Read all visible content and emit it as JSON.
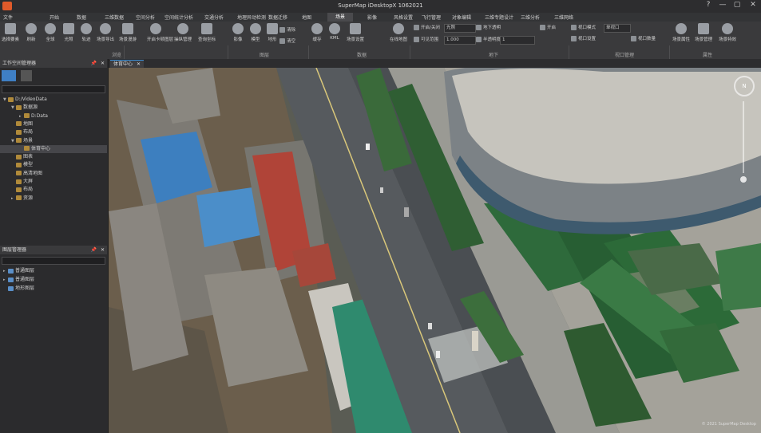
{
  "window": {
    "title": "SuperMap iDesktopX 1062021",
    "minimize": "—",
    "maximize": "▢",
    "close": "✕",
    "help": "?"
  },
  "menu": [
    "文件",
    "开始",
    "数据",
    "三维数据",
    "空间分析",
    "空间统计分析",
    "交通分析",
    "地理异动检测",
    "数据迁移",
    "地图",
    "场景",
    "影像",
    "风格设置",
    "飞行管理",
    "对象编辑",
    "三维专题设计",
    "三维分析",
    "三维网络"
  ],
  "menu_active": "场景",
  "ribbon": {
    "buttons": [
      {
        "label": "选择要素",
        "icon": "select-icon"
      },
      {
        "label": "刷新",
        "icon": "refresh-icon"
      },
      {
        "label": "全球",
        "icon": "globe-icon"
      },
      {
        "label": "光照",
        "icon": "sun-icon"
      },
      {
        "label": "轨迹",
        "icon": "track-icon"
      },
      {
        "label": "场景导出",
        "icon": "export-icon"
      },
      {
        "label": "场景漫游",
        "icon": "roam-icon"
      },
      {
        "label": "开启卡顿图层",
        "icon": "layer-icon"
      },
      {
        "label": "操纵管理",
        "icon": "manage-icon"
      },
      {
        "label": "查询坐标",
        "icon": "coordinate-icon"
      },
      {
        "label": "影像",
        "icon": "image-icon"
      },
      {
        "label": "模型",
        "icon": "model-icon"
      },
      {
        "label": "地形",
        "icon": "terrain-icon"
      },
      {
        "label": "缓存",
        "icon": "cache-icon"
      },
      {
        "label": "KML",
        "icon": "kml-icon"
      },
      {
        "label": "场景设置",
        "icon": "scene-settings-icon"
      },
      {
        "label": "在线地图",
        "icon": "online-map-icon"
      },
      {
        "label": "场景属性",
        "icon": "scene-attr-icon"
      },
      {
        "label": "场景管理",
        "icon": "scene-mgmt-icon"
      },
      {
        "label": "场景特效",
        "icon": "scene-fx-icon"
      }
    ],
    "small_buttons": [
      "清除",
      "清空",
      "开启/关闭",
      "地下透明",
      "可见范围",
      "半透明度",
      "开启",
      "视口模式",
      "视口设置",
      "视口数量"
    ],
    "selects": {
      "underground": "光照",
      "transparency": "1.000",
      "opacity": "1",
      "viewport": "单视口"
    },
    "groups": [
      "浏览",
      "图层",
      "数据",
      "地下",
      "视口管理",
      "属性"
    ]
  },
  "workspace_panel": {
    "title": "工作空间管理器",
    "pin": "📌",
    "close": "✕"
  },
  "tree": [
    {
      "label": "D:/VideoData",
      "level": 0,
      "toggle": "▼"
    },
    {
      "label": "数据源",
      "level": 1,
      "toggle": "▼"
    },
    {
      "label": "D:Data",
      "level": 2,
      "toggle": "▸"
    },
    {
      "label": "地图",
      "level": 1,
      "toggle": ""
    },
    {
      "label": "布局",
      "level": 1,
      "toggle": ""
    },
    {
      "label": "场景",
      "level": 1,
      "toggle": "▼"
    },
    {
      "label": "体育中心",
      "level": 2,
      "toggle": "",
      "selected": true
    },
    {
      "label": "图表",
      "level": 1,
      "toggle": ""
    },
    {
      "label": "模型",
      "level": 1,
      "toggle": ""
    },
    {
      "label": "高清地图",
      "level": 1,
      "toggle": ""
    },
    {
      "label": "大屏",
      "level": 1,
      "toggle": ""
    },
    {
      "label": "布局",
      "level": 1,
      "toggle": ""
    },
    {
      "label": "资源",
      "level": 1,
      "toggle": "▸"
    }
  ],
  "layer_panel": {
    "title": "图层管理器",
    "pin": "📌",
    "close": "✕"
  },
  "layers": [
    {
      "label": "普通图层",
      "toggle": "▸"
    },
    {
      "label": "普通图层",
      "toggle": "▸"
    },
    {
      "label": "地形图层",
      "toggle": ""
    }
  ],
  "scene_tab": {
    "label": "体育中心",
    "close": "✕"
  },
  "compass": "N",
  "watermark": "© 2021 SuperMap Desktop"
}
